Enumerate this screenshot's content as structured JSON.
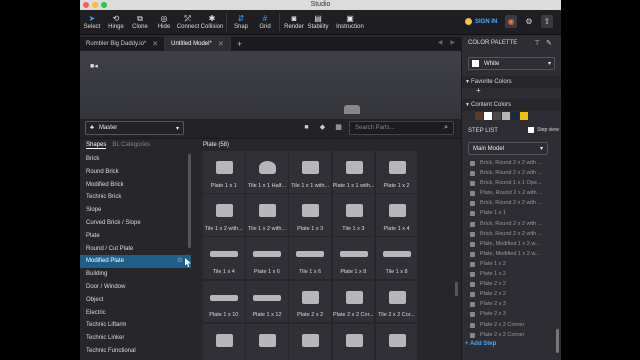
{
  "window": {
    "title": "Studio"
  },
  "toolbar": {
    "items": [
      {
        "label": "Select",
        "icon": "cursor-arrow-icon"
      },
      {
        "label": "Hinge",
        "icon": "hinge-icon"
      },
      {
        "label": "Clone",
        "icon": "clone-icon"
      },
      {
        "label": "Hide",
        "icon": "eye-slash-icon"
      },
      {
        "label": "Connect",
        "icon": "connect-icon"
      },
      {
        "label": "Collision",
        "icon": "collision-icon"
      },
      {
        "label": "Snap",
        "icon": "snap-icon"
      },
      {
        "label": "Grid",
        "icon": "grid-icon"
      },
      {
        "label": "Render",
        "icon": "camera-icon"
      },
      {
        "label": "Stability",
        "icon": "stability-icon"
      },
      {
        "label": "Instruction",
        "icon": "instruction-icon"
      }
    ],
    "sign_in": "SIGN IN"
  },
  "tabs": [
    {
      "label": "Rumbler Big Daddy.io*"
    },
    {
      "label": "Untitled Model*"
    }
  ],
  "shapes": {
    "master_label": "Master",
    "search_placeholder": "Search Parts...",
    "subtab_shapes": "Shapes",
    "subtab_categories": "BL Categories",
    "categories": [
      "Brick",
      "Round Brick",
      "Modified Brick",
      "Technic Brick",
      "Slope",
      "Curved Brick / Slope",
      "Plate",
      "Round / Cut Plate",
      "Modified Plate",
      "Building",
      "Door / Window",
      "Object",
      "Electric",
      "Technic Liftarm",
      "Technic Linker",
      "Technic Functional"
    ],
    "grid_title": "Plate (58)",
    "parts": [
      "Plate 1 x 1",
      "Tile 1 x 1 Half...",
      "Tile 1 x 1 with...",
      "Plate 1 x 1 with...",
      "Plate 1 x 2",
      "Tile 1 x 2 with...",
      "Tile 1 x 2 with...",
      "Plate 1 x 3",
      "Tile 1 x 3",
      "Plate 1 x 4",
      "Tile 1 x 4",
      "Plate 1 x 6",
      "Tile 1 x 6",
      "Plate 1 x 8",
      "Tile 1 x 8",
      "Plate 1 x 10",
      "Plate 1 x 12",
      "Plate 2 x 2",
      "Plate 2 x 2 Cor...",
      "Tile 2 x 2 Cor...",
      "",
      "",
      "",
      "",
      ""
    ]
  },
  "right": {
    "color_palette_title": "COLOR PALETTE",
    "selected_color": "White",
    "favorite_colors": "Favorite Colors",
    "content_colors": "Content Colors",
    "swatches": [
      "#5a3b2a",
      "#ffffff",
      "#4a4a4a",
      "#b5b5b5",
      "#1b2a44",
      "#f2c200"
    ],
    "step_list": "STEP LIST",
    "step_view": "Step view",
    "main_model": "Main Model",
    "steps": [
      "Brick, Round 2 x 2 with ...",
      "Brick, Round 2 x 2 with ...",
      "Brick, Round 1 x 1 Ope...",
      "Plate, Round 2 x 2 with ...",
      "Brick, Round 2 x 2 with ...",
      "Plate 1 x 1",
      "Brick, Round 2 x 2 with ...",
      "Brick, Round 2 x 2 with ...",
      "Plate, Modified 1 x 2 w...",
      "Plate, Modified 1 x 2 w...",
      "Plate 1 x 2",
      "Plate 1 x 2",
      "Plate 2 x 2",
      "Plate 2 x 2",
      "Plate 2 x 3",
      "Plate 2 x 3",
      "Plate 2 x 2 Corner",
      "Plate 2 x 2 Corner"
    ],
    "add_step": "+ Add Step"
  }
}
